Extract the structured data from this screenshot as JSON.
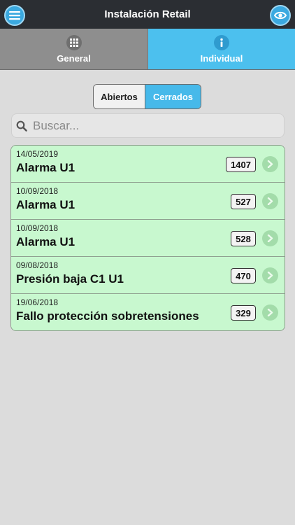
{
  "header": {
    "title": "Instalación Retail",
    "menu_icon": "menu-icon",
    "view_icon": "eye-icon",
    "accent_color": "#3ba9e0"
  },
  "tabs": [
    {
      "label": "General",
      "icon": "grid-icon",
      "active": false
    },
    {
      "label": "Individual",
      "icon": "info-icon",
      "active": true
    }
  ],
  "filter": {
    "options": [
      "Abiertos",
      "Cerrados"
    ],
    "selected": "Cerrados"
  },
  "search": {
    "placeholder": "Buscar...",
    "value": ""
  },
  "alarms": [
    {
      "date": "14/05/2019",
      "title": "Alarma U1",
      "count": "1407"
    },
    {
      "date": "10/09/2018",
      "title": "Alarma U1",
      "count": "527"
    },
    {
      "date": "10/09/2018",
      "title": "Alarma U1",
      "count": "528"
    },
    {
      "date": "09/08/2018",
      "title": "Presión baja C1 U1",
      "count": "470"
    },
    {
      "date": "19/06/2018",
      "title": "Fallo protección sobretensiones",
      "count": "329"
    }
  ],
  "colors": {
    "row_background": "#c8f8cf",
    "active_tab": "#4cc0ee",
    "inactive_tab": "#8e8e8e"
  }
}
